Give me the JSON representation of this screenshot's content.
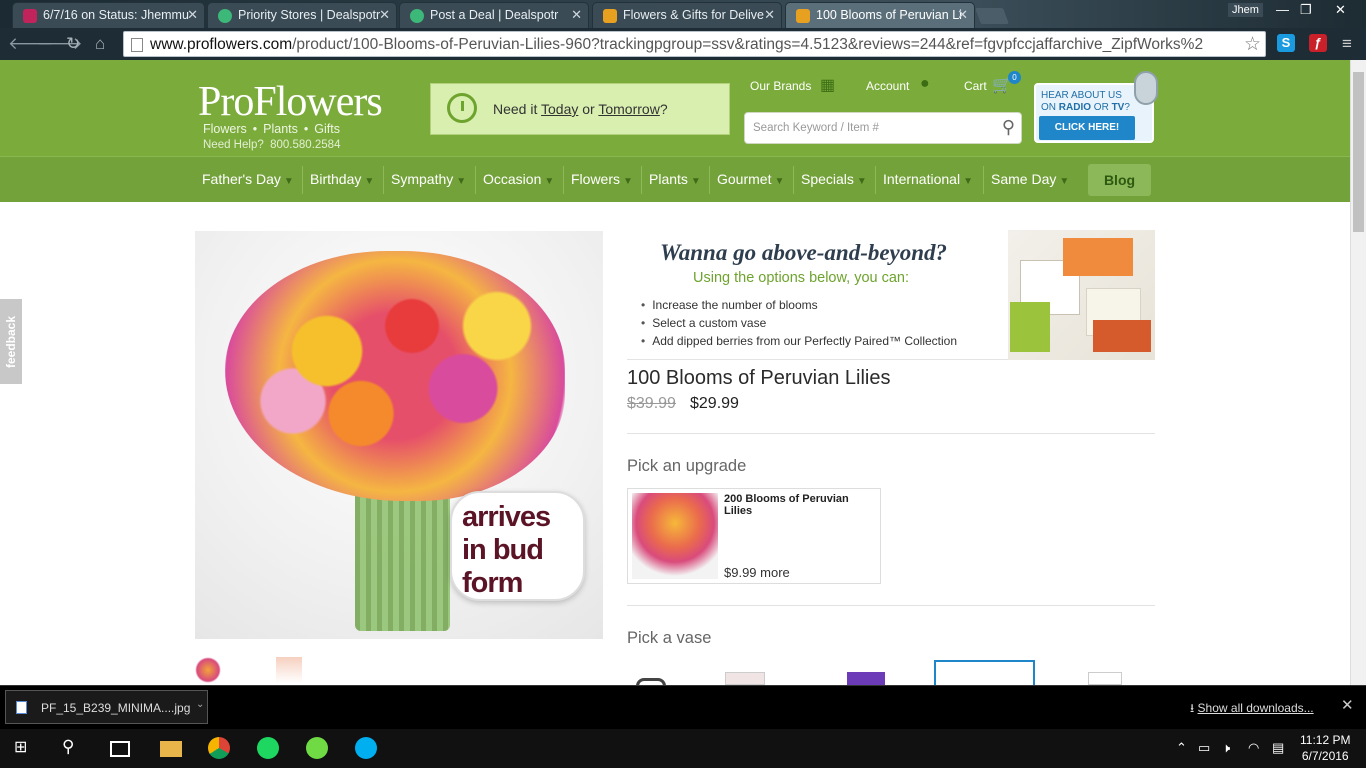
{
  "browser": {
    "tabs": [
      {
        "label": "6/7/16 on Status: Jhemmu",
        "favicon_color": "#c0245a"
      },
      {
        "label": "Priority Stores | Dealspotr",
        "favicon_color": "#3cb878"
      },
      {
        "label": "Post a Deal | Dealspotr",
        "favicon_color": "#3cb878"
      },
      {
        "label": "Flowers & Gifts for Delive",
        "favicon_color": "#e8a020"
      },
      {
        "label": "100 Blooms of Peruvian Li",
        "favicon_color": "#e8a020"
      }
    ],
    "user_name": "Jhem",
    "url_host": "www.proflowers.com",
    "url_path": "/product/100-Blooms-of-Peruvian-Lilies-960?trackingpgroup=ssv&ratings=4.5123&reviews=244&ref=fgvpfccjaffarchive_ZipfWorks%2",
    "extensions": [
      {
        "label": "S",
        "color": "#1a9be0"
      },
      {
        "label": "ƒ",
        "color": "#c9202a"
      }
    ]
  },
  "site": {
    "logo": "ProFlowers",
    "logo_sub": [
      "Flowers",
      "Plants",
      "Gifts"
    ],
    "help_label": "Need Help?",
    "help_phone": "800.580.2584",
    "need_it": {
      "prefix": "Need it ",
      "today": "Today",
      "or": " or ",
      "tomorrow": "Tomorrow",
      "suffix": "?"
    },
    "our_brands": "Our Brands",
    "account": "Account",
    "cart": "Cart",
    "cart_count": "0",
    "search_placeholder": "Search Keyword / Item #",
    "radio": {
      "line1": "HEAR ABOUT US",
      "line2_pre": "ON ",
      "radio": "RADIO",
      "or": " OR ",
      "tv": "TV",
      "q": "?",
      "button": "CLICK HERE!"
    },
    "nav": [
      "Father's Day",
      "Birthday",
      "Sympathy",
      "Occasion",
      "Flowers",
      "Plants",
      "Gourmet",
      "Specials",
      "International",
      "Same Day"
    ],
    "blog": "Blog",
    "feedback": "feedback"
  },
  "product": {
    "badge_lines": [
      "arrives",
      "in bud",
      "form"
    ],
    "promo_heading": "Wanna go above-and-beyond?",
    "promo_sub": "Using the options below, you can:",
    "promo_bullets": [
      "Increase the number of blooms",
      "Select a custom vase",
      "Add dipped berries from our Perfectly Paired™ Collection"
    ],
    "title": "100 Blooms of Peruvian Lilies",
    "old_price": "$39.99",
    "price": "$29.99",
    "upgrade_heading": "Pick an upgrade",
    "upgrade_name": "200 Blooms of Peruvian Lilies",
    "upgrade_more": "$9.99 more",
    "vase_heading": "Pick a vase"
  },
  "downloads": {
    "file": "PF_15_B239_MINIMA....jpg",
    "show_all": "Show all downloads..."
  },
  "taskbar": {
    "time": "11:12 PM",
    "date": "6/7/2016"
  }
}
